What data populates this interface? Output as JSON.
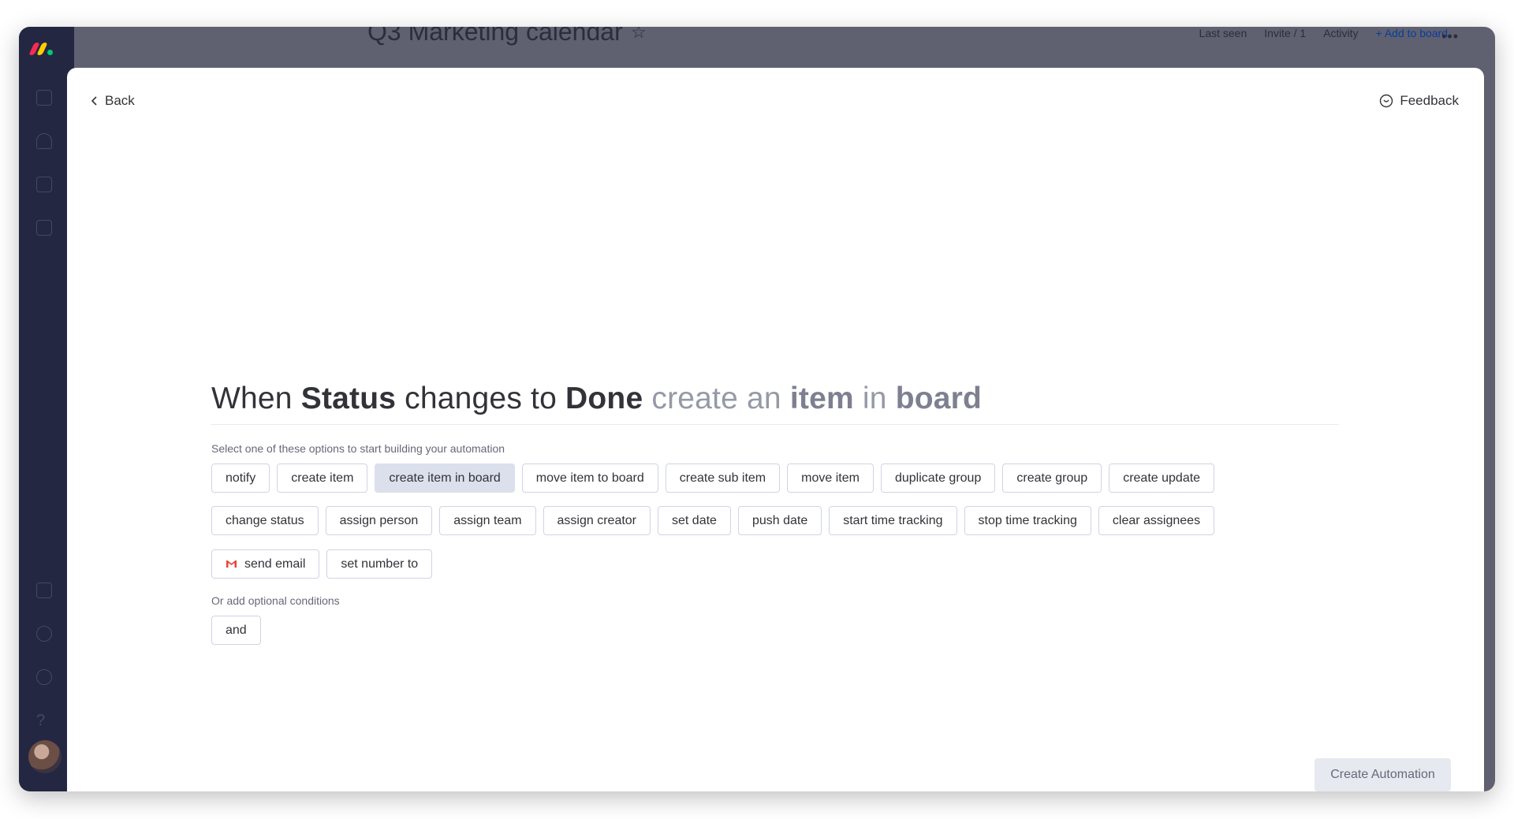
{
  "board": {
    "title": "Q3 Marketing calendar",
    "last_seen_label": "Last seen",
    "invite_label": "Invite / 1",
    "activity_label": "Activity",
    "add_to_board_label": "+ Add to board",
    "more_icon": "more-dots-icon",
    "star_icon": "star-icon"
  },
  "modal": {
    "back_label": "Back",
    "feedback_label": "Feedback",
    "sentence": {
      "when": "When",
      "status": "Status",
      "changes_to": "changes to",
      "done": "Done",
      "create_an": "create an",
      "item": "item",
      "in": "in",
      "board": "board"
    },
    "options_hint": "Select one of these options to start building your automation",
    "conditions_hint": "Or add optional conditions",
    "actions_row1": [
      "notify",
      "create item",
      "create item in board",
      "move item to board",
      "create sub item",
      "move item",
      "duplicate group",
      "create group",
      "create update"
    ],
    "actions_row2": [
      "change status",
      "assign person",
      "assign team",
      "assign creator",
      "set date",
      "push date",
      "start time tracking",
      "stop time tracking",
      "clear assignees"
    ],
    "actions_row3": [
      "send email",
      "set number to"
    ],
    "selected_action": "create item in board",
    "conditions": [
      "and"
    ],
    "create_button_label": "Create Automation"
  },
  "colors": {
    "accent_selected": "#dcdfec",
    "gmail_red": "#ea4335",
    "rail_bg": "#242742"
  }
}
